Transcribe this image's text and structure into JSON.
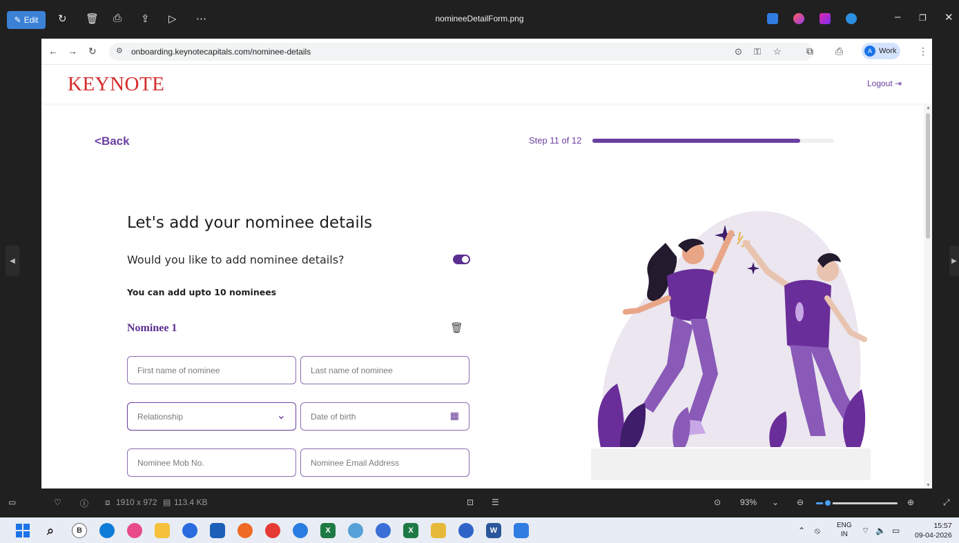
{
  "photos_app": {
    "edit_label": "Edit",
    "file_name": "nomineeDetailForm.png",
    "info": {
      "dimensions": "1910 x 972",
      "file_size": "113.4 KB"
    },
    "zoom": {
      "level": "93%",
      "fraction": 0.93
    }
  },
  "browser": {
    "url": "onboarding.keynotecapitals.com/nominee-details",
    "profile_initial": "A",
    "profile_label": "Work"
  },
  "page": {
    "brand": "KEYNOTE",
    "logout_label": "Logout",
    "back_label": "Back",
    "step_label": "Step 11 of 12",
    "progress_fraction": 0.86,
    "heading": "Let's add your nominee details",
    "question": "Would you like to add nominee details?",
    "toggle_on": true,
    "hint": "You can add upto 10 nominees",
    "nominee_title": "Nominee 1",
    "fields": {
      "first_name": "First name of nominee",
      "last_name": "Last name of nominee",
      "relationship": "Relationship",
      "dob": "Date of birth",
      "mobile": "Nominee Mob No.",
      "email": "Nominee Email Address"
    }
  },
  "taskbar": {
    "language": "ENG",
    "region": "IN",
    "time": "15:57",
    "date": "09-04-2026"
  },
  "colors": {
    "brand_red": "#d42a2a",
    "accent_purple": "#6b3fa0",
    "photos_accent": "#3b82d6"
  }
}
